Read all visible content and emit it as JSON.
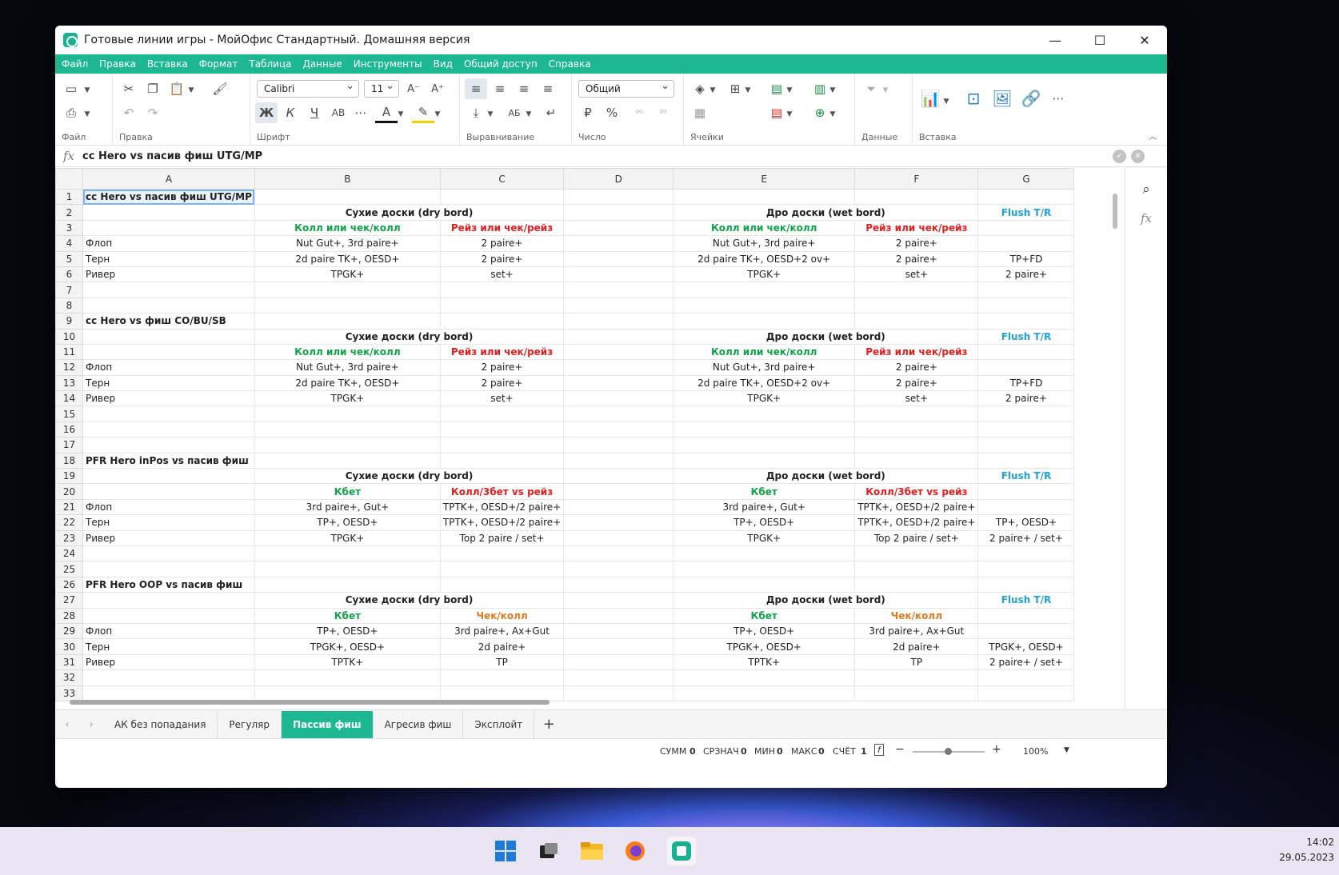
{
  "window": {
    "title": "Готовые линии игры - МойОфис Стандартный. Домашняя версия",
    "controls": [
      "—",
      "☐",
      "✕"
    ]
  },
  "menu": [
    "Файл",
    "Правка",
    "Вставка",
    "Формат",
    "Таблица",
    "Данные",
    "Инструменты",
    "Вид",
    "Общий доступ",
    "Справка"
  ],
  "ribbon": {
    "groups": [
      "Файл",
      "Правка",
      "Шрифт",
      "Выравнивание",
      "Число",
      "Ячейки",
      "Данные",
      "Вставка"
    ],
    "font_name": "Calibri",
    "font_size": "11",
    "number_format": "Общий",
    "buttons": {
      "bold": "Ж",
      "italic": "К",
      "underline": "Ч",
      "strike": "АВ",
      "currency": "₽",
      "percent": "%",
      "grow": "A⁺",
      "shrink": "A⁻"
    }
  },
  "formula_bar": {
    "fx": "fx",
    "value": "cc Hero vs пасив фиш UTG/MP"
  },
  "columns": [
    "A",
    "B",
    "C",
    "D",
    "E",
    "F",
    "G"
  ],
  "rows": [
    {
      "n": "1",
      "cells": [
        {
          "t": "cc Hero vs пасив фиш UTG/MP",
          "s": "b sel"
        },
        {
          "t": ""
        },
        {
          "t": ""
        },
        {
          "t": ""
        },
        {
          "t": ""
        },
        {
          "t": ""
        },
        {
          "t": ""
        }
      ]
    },
    {
      "n": "2",
      "cells": [
        {
          "t": ""
        },
        {
          "t": "Сухие доски (dry bord)",
          "s": "b span"
        },
        {
          "t": "",
          "s": "hide"
        },
        {
          "t": ""
        },
        {
          "t": "Дро доски (wet bord)",
          "s": "b span"
        },
        {
          "t": "",
          "s": "hide"
        },
        {
          "t": "Flush T/R",
          "s": "blue"
        }
      ]
    },
    {
      "n": "3",
      "cells": [
        {
          "t": ""
        },
        {
          "t": "Колл или чек/колл",
          "s": "green"
        },
        {
          "t": "Рейз или чек/рейз",
          "s": "red"
        },
        {
          "t": ""
        },
        {
          "t": "Колл или чек/колл",
          "s": "green"
        },
        {
          "t": "Рейз или чек/рейз",
          "s": "red"
        },
        {
          "t": ""
        }
      ]
    },
    {
      "n": "4",
      "cells": [
        {
          "t": "Флоп"
        },
        {
          "t": "Nut Gut+, 3rd paire+",
          "s": "c"
        },
        {
          "t": "2 paire+",
          "s": "c"
        },
        {
          "t": ""
        },
        {
          "t": "Nut Gut+, 3rd paire+",
          "s": "c"
        },
        {
          "t": "2 paire+",
          "s": "c"
        },
        {
          "t": ""
        }
      ]
    },
    {
      "n": "5",
      "cells": [
        {
          "t": "Терн"
        },
        {
          "t": "2d paire TK+, OESD+",
          "s": "c"
        },
        {
          "t": "2 paire+",
          "s": "c"
        },
        {
          "t": ""
        },
        {
          "t": "2d paire TK+, OESD+2 ov+",
          "s": "c"
        },
        {
          "t": "2 paire+",
          "s": "c"
        },
        {
          "t": "TP+FD",
          "s": "c"
        }
      ]
    },
    {
      "n": "6",
      "cells": [
        {
          "t": "Ривер"
        },
        {
          "t": "TPGK+",
          "s": "c"
        },
        {
          "t": "set+",
          "s": "c"
        },
        {
          "t": ""
        },
        {
          "t": "TPGK+",
          "s": "c"
        },
        {
          "t": "set+",
          "s": "c"
        },
        {
          "t": "2 paire+",
          "s": "c"
        }
      ]
    },
    {
      "n": "7",
      "cells": [
        {
          "t": ""
        },
        {
          "t": ""
        },
        {
          "t": ""
        },
        {
          "t": ""
        },
        {
          "t": ""
        },
        {
          "t": ""
        },
        {
          "t": ""
        }
      ]
    },
    {
      "n": "8",
      "cells": [
        {
          "t": ""
        },
        {
          "t": ""
        },
        {
          "t": ""
        },
        {
          "t": ""
        },
        {
          "t": ""
        },
        {
          "t": ""
        },
        {
          "t": ""
        }
      ]
    },
    {
      "n": "9",
      "cells": [
        {
          "t": "cc Hero vs фиш CO/BU/SB",
          "s": "b"
        },
        {
          "t": ""
        },
        {
          "t": ""
        },
        {
          "t": ""
        },
        {
          "t": ""
        },
        {
          "t": ""
        },
        {
          "t": ""
        }
      ]
    },
    {
      "n": "10",
      "cells": [
        {
          "t": ""
        },
        {
          "t": "Сухие доски (dry bord)",
          "s": "b span"
        },
        {
          "t": "",
          "s": "hide"
        },
        {
          "t": ""
        },
        {
          "t": "Дро доски (wet bord)",
          "s": "b span"
        },
        {
          "t": "",
          "s": "hide"
        },
        {
          "t": "Flush T/R",
          "s": "blue"
        }
      ]
    },
    {
      "n": "11",
      "cells": [
        {
          "t": ""
        },
        {
          "t": "Колл или чек/колл",
          "s": "green"
        },
        {
          "t": "Рейз или чек/рейз",
          "s": "red"
        },
        {
          "t": ""
        },
        {
          "t": "Колл или чек/колл",
          "s": "green"
        },
        {
          "t": "Рейз или чек/рейз",
          "s": "red"
        },
        {
          "t": ""
        }
      ]
    },
    {
      "n": "12",
      "cells": [
        {
          "t": "Флоп"
        },
        {
          "t": "Nut Gut+, 3rd paire+",
          "s": "c"
        },
        {
          "t": "2 paire+",
          "s": "c"
        },
        {
          "t": ""
        },
        {
          "t": "Nut Gut+, 3rd paire+",
          "s": "c"
        },
        {
          "t": "2 paire+",
          "s": "c"
        },
        {
          "t": ""
        }
      ]
    },
    {
      "n": "13",
      "cells": [
        {
          "t": "Терн"
        },
        {
          "t": "2d paire TK+, OESD+",
          "s": "c"
        },
        {
          "t": "2 paire+",
          "s": "c"
        },
        {
          "t": ""
        },
        {
          "t": "2d paire TK+, OESD+2 ov+",
          "s": "c"
        },
        {
          "t": "2 paire+",
          "s": "c"
        },
        {
          "t": "TP+FD",
          "s": "c"
        }
      ]
    },
    {
      "n": "14",
      "cells": [
        {
          "t": "Ривер"
        },
        {
          "t": "TPGK+",
          "s": "c"
        },
        {
          "t": "set+",
          "s": "c"
        },
        {
          "t": ""
        },
        {
          "t": "TPGK+",
          "s": "c"
        },
        {
          "t": "set+",
          "s": "c"
        },
        {
          "t": "2 paire+",
          "s": "c"
        }
      ]
    },
    {
      "n": "15",
      "cells": [
        {
          "t": ""
        },
        {
          "t": ""
        },
        {
          "t": ""
        },
        {
          "t": ""
        },
        {
          "t": ""
        },
        {
          "t": ""
        },
        {
          "t": ""
        }
      ]
    },
    {
      "n": "16",
      "cells": [
        {
          "t": ""
        },
        {
          "t": ""
        },
        {
          "t": ""
        },
        {
          "t": ""
        },
        {
          "t": ""
        },
        {
          "t": ""
        },
        {
          "t": ""
        }
      ]
    },
    {
      "n": "17",
      "cells": [
        {
          "t": ""
        },
        {
          "t": ""
        },
        {
          "t": ""
        },
        {
          "t": ""
        },
        {
          "t": ""
        },
        {
          "t": ""
        },
        {
          "t": ""
        }
      ]
    },
    {
      "n": "18",
      "cells": [
        {
          "t": "PFR Hero inPos vs пасив фиш",
          "s": "b"
        },
        {
          "t": ""
        },
        {
          "t": ""
        },
        {
          "t": ""
        },
        {
          "t": ""
        },
        {
          "t": ""
        },
        {
          "t": ""
        }
      ]
    },
    {
      "n": "19",
      "cells": [
        {
          "t": ""
        },
        {
          "t": "Сухие доски (dry bord)",
          "s": "b span"
        },
        {
          "t": "",
          "s": "hide"
        },
        {
          "t": ""
        },
        {
          "t": "Дро доски (wet bord)",
          "s": "b span"
        },
        {
          "t": "",
          "s": "hide"
        },
        {
          "t": "Flush T/R",
          "s": "blue"
        }
      ]
    },
    {
      "n": "20",
      "cells": [
        {
          "t": ""
        },
        {
          "t": "Кбет",
          "s": "green"
        },
        {
          "t": "Колл/3бет vs рейз",
          "s": "red"
        },
        {
          "t": ""
        },
        {
          "t": "Кбет",
          "s": "green"
        },
        {
          "t": "Колл/3бет vs рейз",
          "s": "red"
        },
        {
          "t": ""
        }
      ]
    },
    {
      "n": "21",
      "cells": [
        {
          "t": "Флоп"
        },
        {
          "t": "3rd paire+, Gut+",
          "s": "c"
        },
        {
          "t": "TPTK+, OESD+/2 paire+",
          "s": "c"
        },
        {
          "t": ""
        },
        {
          "t": "3rd paire+, Gut+",
          "s": "c"
        },
        {
          "t": "TPTK+, OESD+/2 paire+",
          "s": "c"
        },
        {
          "t": ""
        }
      ]
    },
    {
      "n": "22",
      "cells": [
        {
          "t": "Терн"
        },
        {
          "t": "TP+, OESD+",
          "s": "c"
        },
        {
          "t": "TPTK+, OESD+/2 paire+",
          "s": "c"
        },
        {
          "t": ""
        },
        {
          "t": "TP+, OESD+",
          "s": "c"
        },
        {
          "t": "TPTK+, OESD+/2 paire+",
          "s": "c"
        },
        {
          "t": "TP+, OESD+",
          "s": "c"
        }
      ]
    },
    {
      "n": "23",
      "cells": [
        {
          "t": "Ривер"
        },
        {
          "t": "TPGK+",
          "s": "c"
        },
        {
          "t": "Top 2 paire / set+",
          "s": "c"
        },
        {
          "t": ""
        },
        {
          "t": "TPGK+",
          "s": "c"
        },
        {
          "t": "Top 2 paire / set+",
          "s": "c"
        },
        {
          "t": "2 paire+ / set+",
          "s": "c"
        }
      ]
    },
    {
      "n": "24",
      "cells": [
        {
          "t": ""
        },
        {
          "t": ""
        },
        {
          "t": ""
        },
        {
          "t": ""
        },
        {
          "t": ""
        },
        {
          "t": ""
        },
        {
          "t": ""
        }
      ]
    },
    {
      "n": "25",
      "cells": [
        {
          "t": ""
        },
        {
          "t": ""
        },
        {
          "t": ""
        },
        {
          "t": ""
        },
        {
          "t": ""
        },
        {
          "t": ""
        },
        {
          "t": ""
        }
      ]
    },
    {
      "n": "26",
      "cells": [
        {
          "t": "PFR Hero OOP vs пасив фиш",
          "s": "b"
        },
        {
          "t": ""
        },
        {
          "t": ""
        },
        {
          "t": ""
        },
        {
          "t": ""
        },
        {
          "t": ""
        },
        {
          "t": ""
        }
      ]
    },
    {
      "n": "27",
      "cells": [
        {
          "t": ""
        },
        {
          "t": "Сухие доски (dry bord)",
          "s": "b span"
        },
        {
          "t": "",
          "s": "hide"
        },
        {
          "t": ""
        },
        {
          "t": "Дро доски (wet bord)",
          "s": "b span"
        },
        {
          "t": "",
          "s": "hide"
        },
        {
          "t": "Flush T/R",
          "s": "blue"
        }
      ]
    },
    {
      "n": "28",
      "cells": [
        {
          "t": ""
        },
        {
          "t": "Кбет",
          "s": "green"
        },
        {
          "t": "Чек/колл",
          "s": "orange"
        },
        {
          "t": ""
        },
        {
          "t": "Кбет",
          "s": "green"
        },
        {
          "t": "Чек/колл",
          "s": "orange"
        },
        {
          "t": ""
        }
      ]
    },
    {
      "n": "29",
      "cells": [
        {
          "t": "Флоп"
        },
        {
          "t": "TP+, OESD+",
          "s": "c"
        },
        {
          "t": "3rd paire+, Ax+Gut",
          "s": "c"
        },
        {
          "t": ""
        },
        {
          "t": "TP+, OESD+",
          "s": "c"
        },
        {
          "t": "3rd paire+, Ax+Gut",
          "s": "c"
        },
        {
          "t": ""
        }
      ]
    },
    {
      "n": "30",
      "cells": [
        {
          "t": "Терн"
        },
        {
          "t": "TPGK+, OESD+",
          "s": "c"
        },
        {
          "t": "2d paire+",
          "s": "c"
        },
        {
          "t": ""
        },
        {
          "t": "TPGK+, OESD+",
          "s": "c"
        },
        {
          "t": "2d paire+",
          "s": "c"
        },
        {
          "t": "TPGK+, OESD+",
          "s": "c"
        }
      ]
    },
    {
      "n": "31",
      "cells": [
        {
          "t": "Ривер"
        },
        {
          "t": "TPTK+",
          "s": "c"
        },
        {
          "t": "TP",
          "s": "c"
        },
        {
          "t": ""
        },
        {
          "t": "TPTK+",
          "s": "c"
        },
        {
          "t": "TP",
          "s": "c"
        },
        {
          "t": "2 paire+ / set+",
          "s": "c"
        }
      ]
    },
    {
      "n": "32",
      "cells": [
        {
          "t": ""
        },
        {
          "t": ""
        },
        {
          "t": ""
        },
        {
          "t": ""
        },
        {
          "t": ""
        },
        {
          "t": ""
        },
        {
          "t": ""
        }
      ]
    },
    {
      "n": "33",
      "cells": [
        {
          "t": ""
        },
        {
          "t": ""
        },
        {
          "t": ""
        },
        {
          "t": ""
        },
        {
          "t": ""
        },
        {
          "t": ""
        },
        {
          "t": ""
        }
      ]
    }
  ],
  "sheet_tabs": [
    "АК без попадания",
    "Регуляр",
    "Пассив фиш",
    "Агресив фиш",
    "Эксплойт"
  ],
  "active_tab": "Пассив фиш",
  "status": {
    "sum_label": "СУММ",
    "sum": "0",
    "avg_label": "СРЗНАЧ",
    "avg": "0",
    "min_label": "МИН",
    "min": "0",
    "max_label": "МАКС",
    "max": "0",
    "count_label": "СЧЁТ",
    "count": "1",
    "zoom": "100%"
  },
  "clock": {
    "time": "14:02",
    "date": "29.05.2023"
  },
  "colors": {
    "accent": "#1db892",
    "green": "#12a24a",
    "red": "#e02020",
    "orange": "#e07b22",
    "blue": "#22a0d8"
  }
}
